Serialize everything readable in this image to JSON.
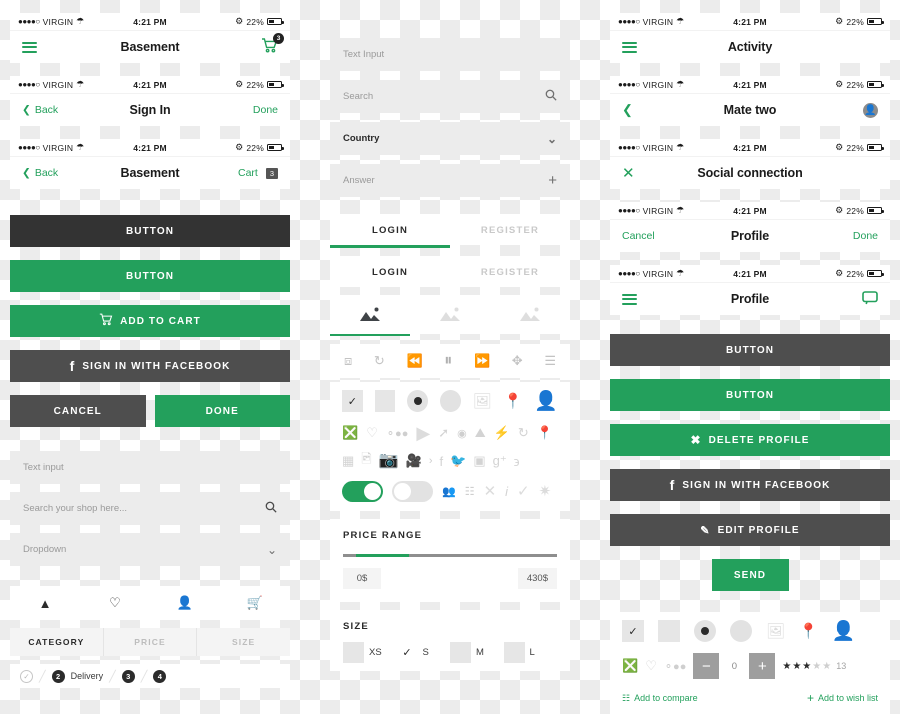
{
  "status_bar": {
    "carrier": "VIRGIN",
    "signal_dots": "●●●●○",
    "wifi_icon": "wifi-icon",
    "time": "4:21 PM",
    "bluetooth_icon": "bluetooth-icon",
    "battery_percent": "22%",
    "battery_icon": "battery-icon"
  },
  "colors": {
    "green": "#23a05c",
    "dark": "#333333",
    "grey_button": "#4e4e4e",
    "field_bg": "#ececec"
  },
  "left_column": {
    "navbars": [
      {
        "left_icon": "hamburger-icon",
        "title": "Basement",
        "right_icon": "cart-icon",
        "badge": "3"
      },
      {
        "left_icon": "chevron-left-icon",
        "left_label": "Back",
        "title": "Sign In",
        "right_label": "Done"
      },
      {
        "left_icon": "chevron-left-icon",
        "left_label": "Back",
        "title": "Basement",
        "right_label": "Cart",
        "badge": "3"
      }
    ],
    "buttons": [
      {
        "label": "BUTTON",
        "style": "dark"
      },
      {
        "label": "BUTTON",
        "style": "green"
      },
      {
        "label": "ADD TO CART",
        "style": "green",
        "icon": "cart-icon"
      },
      {
        "label": "SIGN IN WITH FACEBOOK",
        "style": "grey",
        "icon": "facebook-icon"
      }
    ],
    "button_pair": [
      {
        "label": "CANCEL",
        "style": "grey"
      },
      {
        "label": "DONE",
        "style": "green"
      }
    ],
    "fields": [
      {
        "placeholder": "Text input",
        "icon": ""
      },
      {
        "placeholder": "Search your shop here...",
        "icon": "search-icon"
      },
      {
        "placeholder": "Dropdown",
        "icon": "chevron-down-icon"
      }
    ],
    "tabbar_icons": [
      "chart-bar-icon",
      "heart-icon",
      "user-icon",
      "cart-icon"
    ],
    "segments": [
      {
        "label": "CATEGORY",
        "active": true
      },
      {
        "label": "PRICE",
        "active": false
      },
      {
        "label": "SIZE",
        "active": false
      }
    ],
    "steps": [
      {
        "mark": "✓",
        "label": "",
        "done": true
      },
      {
        "mark": "2",
        "label": "Delivery",
        "done": false
      },
      {
        "mark": "3",
        "label": "",
        "done": false
      },
      {
        "mark": "4",
        "label": "",
        "done": false
      }
    ]
  },
  "middle_column": {
    "fields": [
      {
        "placeholder": "Text Input",
        "icon": ""
      },
      {
        "placeholder": "Search",
        "icon": "search-icon"
      },
      {
        "value": "Country",
        "icon": "chevron-down-icon"
      },
      {
        "placeholder": "Answer",
        "icon": "plus-icon"
      }
    ],
    "tabs_underlined": [
      {
        "label": "LOGIN",
        "active": true
      },
      {
        "label": "REGISTER",
        "active": false
      }
    ],
    "tabs_plain": [
      {
        "label": "LOGIN",
        "active": true
      },
      {
        "label": "REGISTER",
        "active": false
      }
    ],
    "tabs_image": [
      {
        "icon": "image-icon",
        "active": true
      },
      {
        "icon": "image-icon",
        "active": false
      },
      {
        "icon": "image-icon",
        "active": false
      }
    ],
    "media_controls": [
      "expand-icon",
      "repeat-icon",
      "rewind-icon",
      "pause-icon",
      "fast-forward-icon",
      "shuffle-icon",
      "playlist-icon"
    ],
    "control_row_1": [
      "checkbox-checked-icon",
      "checkbox-empty-icon",
      "radio-selected-icon",
      "radio-empty-icon",
      "image-icon",
      "map-pin-icon",
      "avatar-icon"
    ],
    "control_row_2": [
      "close-circle-icon",
      "heart-icon",
      "dots-icon",
      "play-circle-icon",
      "share-icon",
      "record-icon",
      "image-icon",
      "flash-icon",
      "refresh-icon",
      "pin-download-icon"
    ],
    "control_row_3": [
      "grid-icon",
      "photo-icon",
      "camera-icon",
      "video-icon",
      "chevron-right-icon",
      "facebook-icon",
      "twitter-icon",
      "instagram-icon",
      "google-plus-icon",
      "blogger-icon"
    ],
    "control_row_4": [
      "toggle-on-icon",
      "toggle-off-icon",
      "add-user-icon",
      "chart-bar-icon",
      "close-icon",
      "info-icon",
      "check-icon",
      "gear-icon"
    ],
    "price_range": {
      "title": "PRICE RANGE",
      "min_label": "0$",
      "max_label": "430$",
      "fill_start_pct": 6,
      "fill_width_pct": 25
    },
    "size": {
      "title": "SIZE",
      "options": [
        {
          "label": "XS",
          "selected": false
        },
        {
          "label": "S",
          "selected": true
        },
        {
          "label": "M",
          "selected": false
        },
        {
          "label": "L",
          "selected": false
        }
      ]
    }
  },
  "right_column": {
    "navbars": [
      {
        "left_icon": "hamburger-icon",
        "title": "Activity"
      },
      {
        "left_icon": "chevron-left-icon",
        "title": "Mate two",
        "right_icon": "avatar-icon"
      },
      {
        "left_icon": "close-icon",
        "title": "Social connection"
      },
      {
        "left_label": "Cancel",
        "title": "Profile",
        "right_label": "Done"
      },
      {
        "left_icon": "hamburger-icon",
        "title": "Profile",
        "right_icon": "chat-icon"
      }
    ],
    "buttons": [
      {
        "label": "BUTTON",
        "style": "grey"
      },
      {
        "label": "BUTTON",
        "style": "green"
      },
      {
        "label": "DELETE PROFILE",
        "style": "green",
        "icon": "close-circle-icon"
      },
      {
        "label": "SIGN IN WITH FACEBOOK",
        "style": "grey",
        "icon": "facebook-icon"
      },
      {
        "label": "EDIT PROFILE",
        "style": "grey",
        "icon": "pencil-icon"
      }
    ],
    "send_button": {
      "label": "SEND",
      "style": "green"
    },
    "control_row_1": [
      "checkbox-checked-icon",
      "checkbox-empty-icon",
      "radio-selected-icon",
      "radio-empty-icon",
      "image-icon",
      "map-pin-icon",
      "avatar-icon"
    ],
    "stepper": {
      "minus": "−",
      "value": "0",
      "plus": "+"
    },
    "rating": {
      "filled": 3,
      "total": 5,
      "count": "13"
    },
    "links": [
      {
        "label": "Add to compare",
        "icon": "chart-bar-icon"
      },
      {
        "label": "Add to wish list",
        "icon": "plus-icon"
      }
    ]
  }
}
